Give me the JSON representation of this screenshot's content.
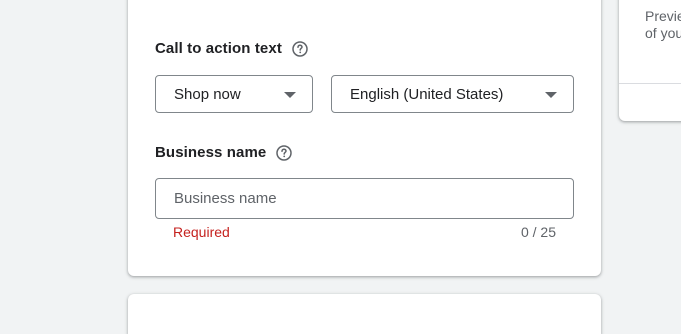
{
  "cta": {
    "label": "Call to action text",
    "help_icon": "help-circle-icon",
    "selected": "Shop now",
    "language_selected": "English (United States)"
  },
  "business_name": {
    "label": "Business name",
    "help_icon": "help-circle-icon",
    "placeholder": "Business name",
    "value": "",
    "error": "Required",
    "counter": "0 / 25"
  },
  "preview": {
    "line1": "Previe",
    "line2": "of you"
  },
  "colors": {
    "error": "#c5221f",
    "border": "#80868b",
    "background": "#f1f3f4"
  }
}
